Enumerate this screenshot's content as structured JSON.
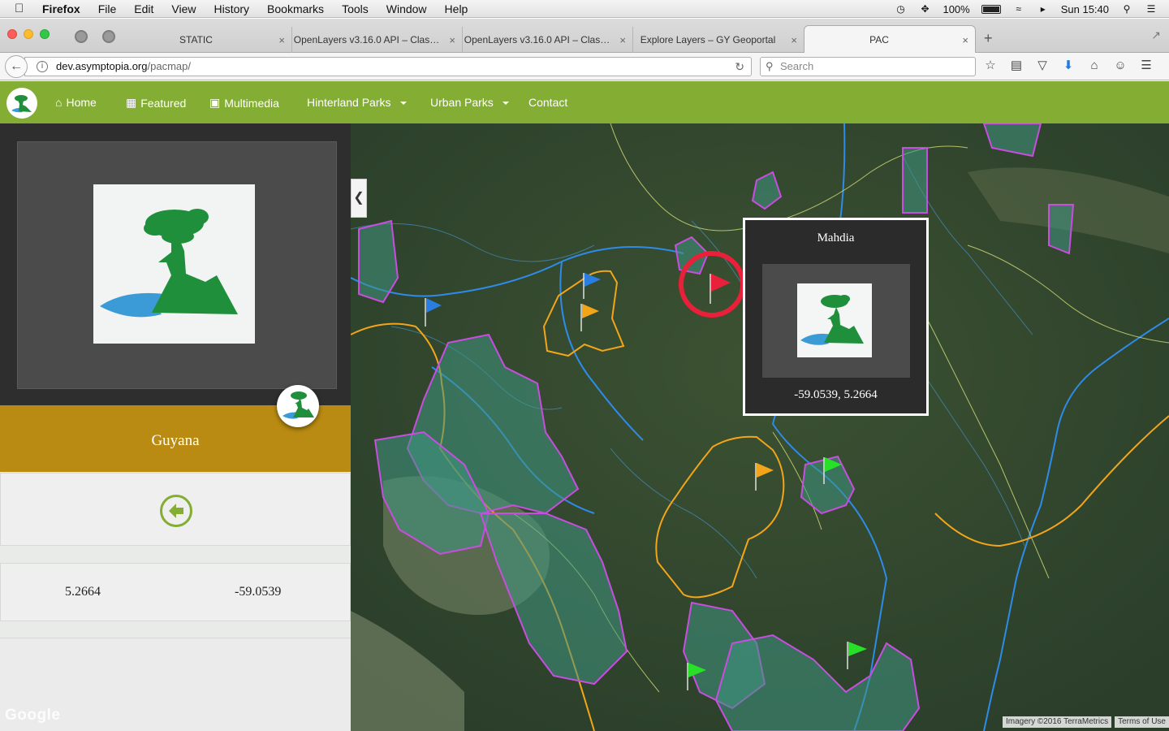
{
  "menubar": {
    "app_name": "Firefox",
    "items": [
      "File",
      "Edit",
      "View",
      "History",
      "Bookmarks",
      "Tools",
      "Window",
      "Help"
    ],
    "battery_percent": "100%",
    "clock": "Sun 15:40"
  },
  "tabs": [
    {
      "label": "STATIC",
      "close": "×"
    },
    {
      "label": "OpenLayers v3.16.0 API – Clas…",
      "close": "×"
    },
    {
      "label": "OpenLayers v3.16.0 API – Clas…",
      "close": "×"
    },
    {
      "label": "Explore Layers – GY Geoportal",
      "close": "×"
    },
    {
      "label": "PAC",
      "close": "×"
    }
  ],
  "new_tab_symbol": "+",
  "urlbar": {
    "host": "dev.asymptopia.org",
    "path": "/pacmap/"
  },
  "search": {
    "placeholder": "Search"
  },
  "site_nav": {
    "items": [
      {
        "label": "Home",
        "icon": "home-icon"
      },
      {
        "label": "Featured",
        "icon": "film-icon"
      },
      {
        "label": "Multimedia",
        "icon": "picture-icon"
      },
      {
        "label": "Hinterland Parks",
        "dropdown": true
      },
      {
        "label": "Urban Parks",
        "dropdown": true
      },
      {
        "label": "Contact"
      }
    ],
    "colors": {
      "bar": "#83ae33",
      "title_band": "#b98b13"
    }
  },
  "sidebar": {
    "title": "Guyana",
    "lat": "5.2664",
    "lon": "-59.0539",
    "watermark": "Google"
  },
  "popup": {
    "title": "Mahdia",
    "coords": "-59.0539, 5.2664"
  },
  "map": {
    "markers": [
      {
        "color": "blue",
        "hex": "#2a7de1"
      },
      {
        "color": "blue",
        "hex": "#2a7de1"
      },
      {
        "color": "orange",
        "hex": "#f3a51a"
      },
      {
        "color": "red",
        "hex": "#e8203a",
        "selected": true
      },
      {
        "color": "orange",
        "hex": "#f3a51a"
      },
      {
        "color": "green",
        "hex": "#27e027"
      },
      {
        "color": "green",
        "hex": "#27e027"
      },
      {
        "color": "green",
        "hex": "#27e027"
      }
    ],
    "attribution": "Imagery ©2016 TerraMetrics",
    "terms": "Terms of Use"
  }
}
